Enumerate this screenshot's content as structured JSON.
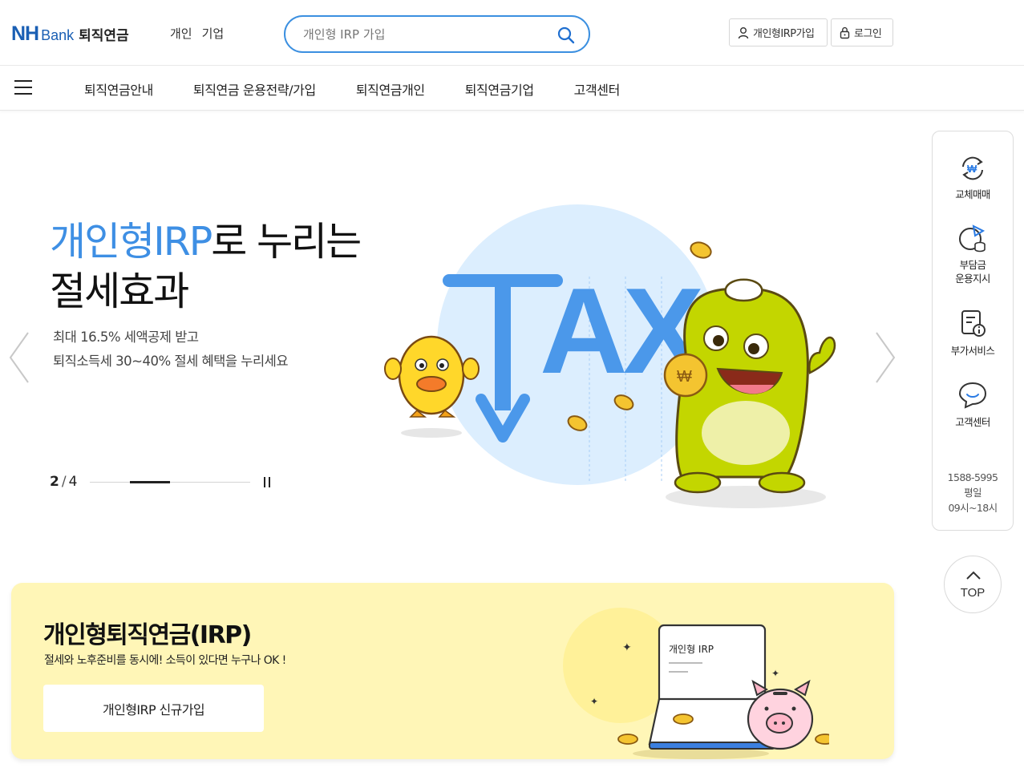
{
  "header": {
    "logo_nh": "NH",
    "logo_bank": "Bank",
    "logo_service": "퇴직연금",
    "links": [
      "개인",
      "기업"
    ],
    "search_placeholder": "개인형 IRP 가입",
    "join_button": "개인형IRP가입",
    "login_button": "로그인"
  },
  "gnb": {
    "items": [
      "퇴직연금안내",
      "퇴직연금 운용전략/가입",
      "퇴직연금개인",
      "퇴직연금기업",
      "고객센터"
    ]
  },
  "hero": {
    "title_highlight": "개인형IRP",
    "title_rest": "로 누리는",
    "title_line2": "절세효과",
    "sub_line1": "최대 16.5% 세액공제 받고",
    "sub_line2": "퇴직소득세 30~40% 절세 혜택을 누리세요",
    "illustration_text": "TAX",
    "current_slide": "2",
    "total_slides": "4",
    "slide_progress": 0.5,
    "accent_color": "#3e8fe4"
  },
  "quick_menu": {
    "items": [
      {
        "label": "교체매매",
        "icon": "exchange-icon"
      },
      {
        "label": "부담금 운용지시",
        "line1": "부담금",
        "line2": "운용지시",
        "icon": "chart-coin-icon"
      },
      {
        "label": "부가서비스",
        "icon": "document-info-icon"
      },
      {
        "label": "고객센터",
        "icon": "chat-icon"
      }
    ],
    "phone": "1588-5995",
    "hours_label": "평일",
    "hours": "09시~18시",
    "top_label": "TOP"
  },
  "irp_banner": {
    "title": "개인형퇴직연금(IRP)",
    "subtitle": "절세와 노후준비를 동시에! 소득이 있다면 누구나 OK !",
    "button": "개인형IRP 신규가입",
    "card_label": "개인형 IRP",
    "bg_color": "#fff6b7"
  }
}
